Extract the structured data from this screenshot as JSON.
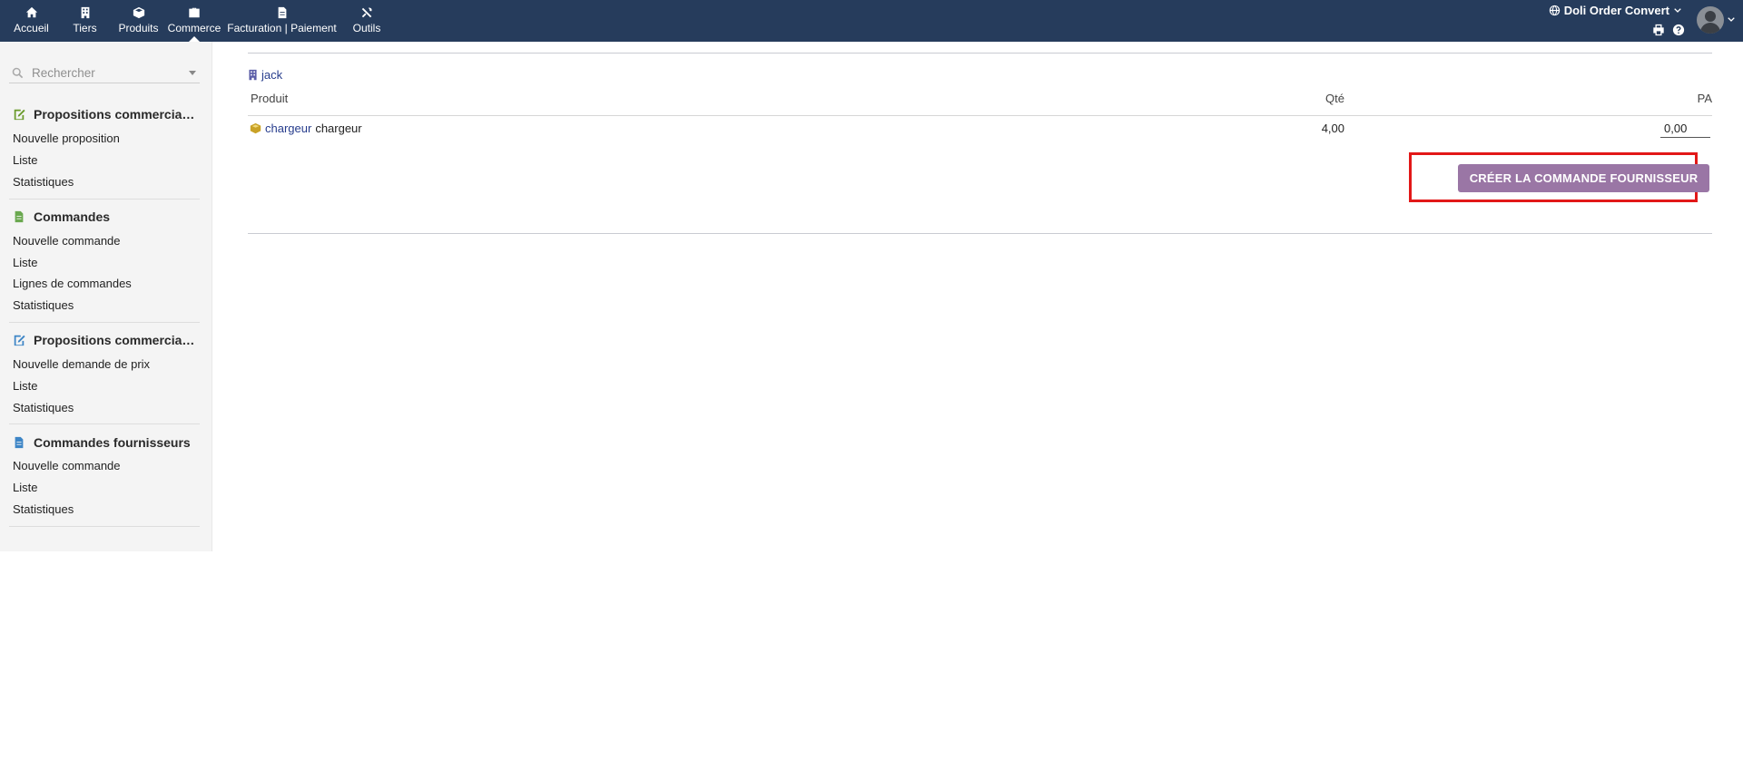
{
  "topnav": {
    "items": [
      {
        "label": "Accueil",
        "icon": "home-icon"
      },
      {
        "label": "Tiers",
        "icon": "building-icon"
      },
      {
        "label": "Produits",
        "icon": "cube-icon"
      },
      {
        "label": "Commerce",
        "icon": "briefcase-icon",
        "active": true
      },
      {
        "label": "Facturation | Paiement",
        "icon": "file-icon"
      },
      {
        "label": "Outils",
        "icon": "tools-icon"
      }
    ],
    "entity_name": "Doli Order Convert"
  },
  "sidebar": {
    "search_placeholder": "Rechercher",
    "sections": [
      {
        "title": "Propositions commerciales",
        "icon": "proposal-icon",
        "links": [
          "Nouvelle proposition",
          "Liste",
          "Statistiques"
        ]
      },
      {
        "title": "Commandes",
        "icon": "order-icon",
        "links": [
          "Nouvelle commande",
          "Liste",
          "Lignes de commandes",
          "Statistiques"
        ]
      },
      {
        "title": "Propositions commerciale ...",
        "icon": "supplier-proposal-icon",
        "links": [
          "Nouvelle demande de prix",
          "Liste",
          "Statistiques"
        ]
      },
      {
        "title": "Commandes fournisseurs",
        "icon": "supplier-order-icon",
        "links": [
          "Nouvelle commande",
          "Liste",
          "Statistiques"
        ]
      }
    ]
  },
  "main": {
    "thirdparty": "jack",
    "table": {
      "headers": {
        "product": "Produit",
        "qty": "Qté",
        "pa": "PA"
      },
      "rows": [
        {
          "ref": "chargeur",
          "label": "chargeur",
          "qty": "4,00",
          "pa": "0,00"
        }
      ]
    },
    "create_button": "CRÉER LA COMMANDE FOURNISSEUR"
  },
  "colors": {
    "topbar": "#263c5c",
    "button": "#9a76a5",
    "highlight": "#e21818",
    "link": "#263c8c"
  }
}
